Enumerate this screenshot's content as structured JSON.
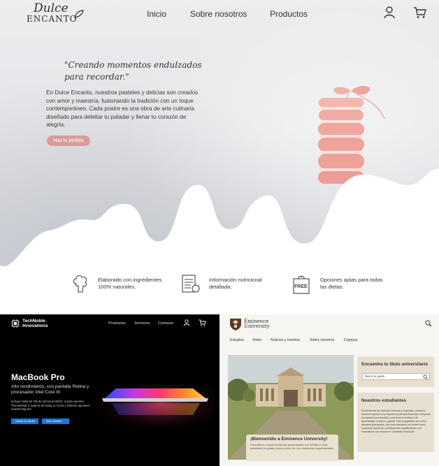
{
  "dulce": {
    "logo_script": "Dulce",
    "logo_caps": "ENCANTO",
    "nav": [
      "Inicio",
      "Sobre nosotros",
      "Productos"
    ],
    "tagline_line1": "\"Creando momentos endulzados",
    "tagline_line2": "para recordar.\"",
    "paragraph": "En Dulce Encanto, nuestros pasteles y delicias son creados con amor y maestría, fusionando la tradición con un toque contemporáneo. Cada postre es una obra de arte culinaria diseñado para deleitar tu paladar y llenar tu corazón de alegría.",
    "cta": "Haz tu pedido",
    "features": [
      {
        "icon": "broccoli-icon",
        "text": "Elaborado con ingredientes 100% naturales."
      },
      {
        "icon": "nutrition-label-icon",
        "text": "Información nutricional detallada."
      },
      {
        "icon": "free-badge-icon",
        "text": "Opciones aptas para todas las dietas."
      }
    ],
    "free_badge": "FREE",
    "colors": {
      "accent": "#d99c9c",
      "text": "#333333"
    }
  },
  "tech": {
    "brand_line1": "TechNoble",
    "brand_line2": "Innovations",
    "nav": [
      "Productos",
      "Servicios",
      "Contacto"
    ],
    "title": "MacBook Pro",
    "subtitle": "Alto rendimiento, con pantalla Retina y procesador Intel Core i9.",
    "description": "Incluye hasta 64 GB de memoria DDR4. Cuatro puertos Thunderbolt 3, batería de hasta 11 horas y sistema operativo macOS Big Sur.",
    "buttons": [
      "Añadir al carrito",
      "Más detalles"
    ],
    "colors": {
      "accent": "#1878d6",
      "bg": "#000000"
    }
  },
  "emi": {
    "name_line1": "Éminence",
    "name_line2": "University",
    "nav": [
      "Estudios",
      "Visita",
      "Noticias y eventos",
      "Sobre nosotros",
      "Campus"
    ],
    "welcome_title": "¡Bienvenido a Éminence University!",
    "welcome_text": "Descubre un mundo donde las oportunidades son infinitas y cada estudiante es guiado hacia el éxito con un compromiso inquebrantable.",
    "card1_title": "Encuentra tu título universitario",
    "search_placeholder": "Busca tu grado",
    "card2_title": "Nuestros estudiantes",
    "card2_text": "Provenientes de diversas culturas y contextos, nuestros alumnos aportan una riqueza de perspectivas que enriquece la experiencia educativa y fomenta un entorno de aprendizaje inclusivo y global. Nos enorgullece ver cómo nuestros graduados, con una educación de primer nivel, continúan haciendo contribuciones significativas a la sociedad en un mundo en constante evolución.",
    "colors": {
      "card": "#e7dfcf",
      "bg": "#f7f5f1"
    }
  }
}
